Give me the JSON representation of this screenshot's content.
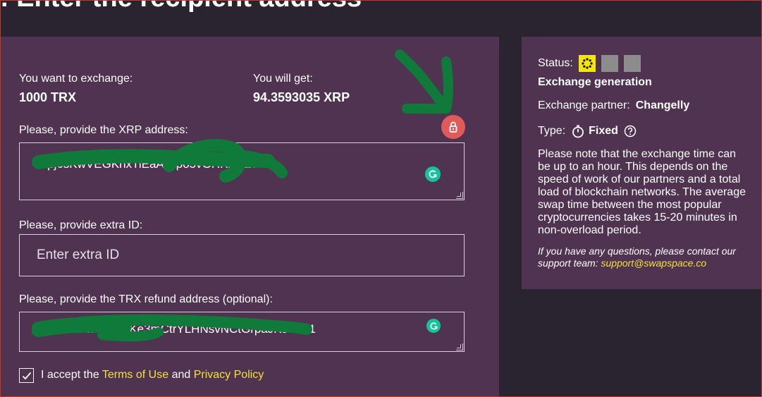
{
  "header": {
    "title": ": Enter the recipient address"
  },
  "exchange": {
    "want_label": "You want to exchange:",
    "want_value": "1000 TRX",
    "get_label": "You will get:",
    "get_value": "94.3593035 XRP"
  },
  "form": {
    "xrp_label": "Please, provide the XRP address:",
    "xrp_value": "r9pj6sKwVEGKnxTiEaAHtpo5vGHKhfsZ7",
    "extra_label": "Please, provide extra ID:",
    "extra_placeholder": "Enter extra ID",
    "refund_label": "Please, provide the TRX refund address (optional):",
    "refund_value": "TXr8DnPwQsvgqKe3mCtrYLHNsvNCtGrpaJKs3TZ1",
    "terms_prefix": "I accept the ",
    "terms_link": "Terms of Use",
    "terms_mid": " and ",
    "privacy_link": "Privacy Policy",
    "terms_checked": true
  },
  "sidebar": {
    "status_label": "Status:",
    "status_text": "Exchange generation",
    "partner_label": "Exchange partner:",
    "partner_value": "Changelly",
    "type_label": "Type:",
    "type_value": "Fixed",
    "note": "Please note that the exchange time can be up to an hour. This depends on the speed of work of our partners and a total load of blockchain networks. The average swap time between the most popular cryptocurrencies takes 15-20 minutes in non-overload period.",
    "contact_prefix": "If you have any questions, please contact our support team: ",
    "contact_email": "support@swapspace.co"
  },
  "colors": {
    "panel": "#4f3350",
    "background": "#2a2430",
    "link": "#f2e23a",
    "status_active": "#f2e60d",
    "status_inactive": "#8c8c8c",
    "lock_badge": "#e05a5a",
    "grammarly": "#15c39a",
    "scribble": "#0f7a3a"
  },
  "icons": {
    "lock": "lock-icon",
    "grammarly": "grammarly-icon",
    "stopwatch": "stopwatch-icon",
    "help": "help-circle-icon",
    "check": "check-icon",
    "spinner": "spinner-icon"
  }
}
